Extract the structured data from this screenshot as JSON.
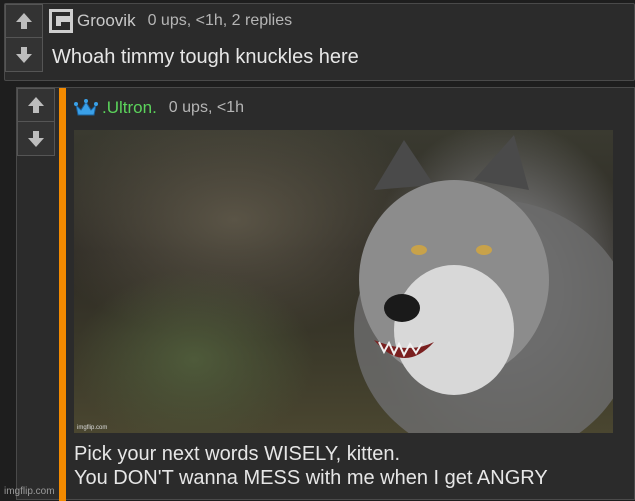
{
  "comment1": {
    "username": "Groovik",
    "meta": "0 ups, <1h, 2 replies",
    "text": "Whoah timmy tough knuckles here"
  },
  "comment2": {
    "username": ".Ultron.",
    "meta": "0 ups, <1h",
    "image_watermark": "imgflip.com",
    "line1": "Pick your next words WISELY, kitten.",
    "line2": "You DON'T wanna MESS with me when I get ANGRY"
  },
  "footer_watermark": "imgflip.com",
  "colors": {
    "background": "#1e1e1e",
    "comment_bg": "#2b2b2b",
    "reply_stripe": "#f38a00",
    "username_green": "#5bd35b",
    "crown_blue": "#3aa0e8"
  },
  "icons": [
    "up-arrow-icon",
    "down-arrow-icon",
    "user-logo-icon",
    "crown-icon"
  ]
}
